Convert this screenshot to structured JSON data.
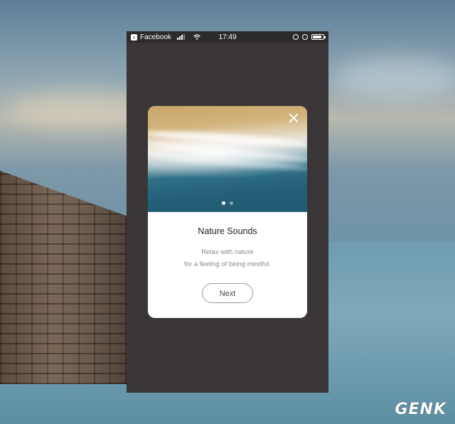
{
  "status_bar": {
    "back_app": "Facebook",
    "time": "17:49",
    "battery_level": 0.85
  },
  "modal": {
    "title": "Nature Sounds",
    "description_line1": "Relax with nature",
    "description_line2": "for a feeling of being mindful.",
    "next_label": "Next",
    "carousel": {
      "total": 2,
      "active_index": 0
    }
  },
  "watermark": "GENK",
  "icons": [
    "back-chevron-icon",
    "signal-icon",
    "wifi-icon",
    "rotation-lock-icon",
    "alarm-icon",
    "battery-icon",
    "close-icon"
  ]
}
